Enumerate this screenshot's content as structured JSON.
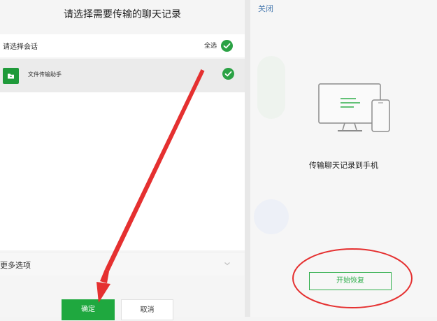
{
  "left": {
    "title": "请选择需要传输的聊天记录",
    "select_label": "请选择会话",
    "select_all": "全选",
    "chats": [
      {
        "name": "文件传输助手",
        "icon": "folder-icon",
        "selected": true
      }
    ],
    "more_options": "更多选项",
    "confirm": "确定",
    "cancel": "取消"
  },
  "right": {
    "close": "关闭",
    "transfer_text": "传输聊天记录到手机",
    "restore": "开始恢复"
  },
  "colors": {
    "wechat_green": "#2ba245",
    "annotation_red": "#e53030",
    "link_blue": "#4a7bb0"
  }
}
